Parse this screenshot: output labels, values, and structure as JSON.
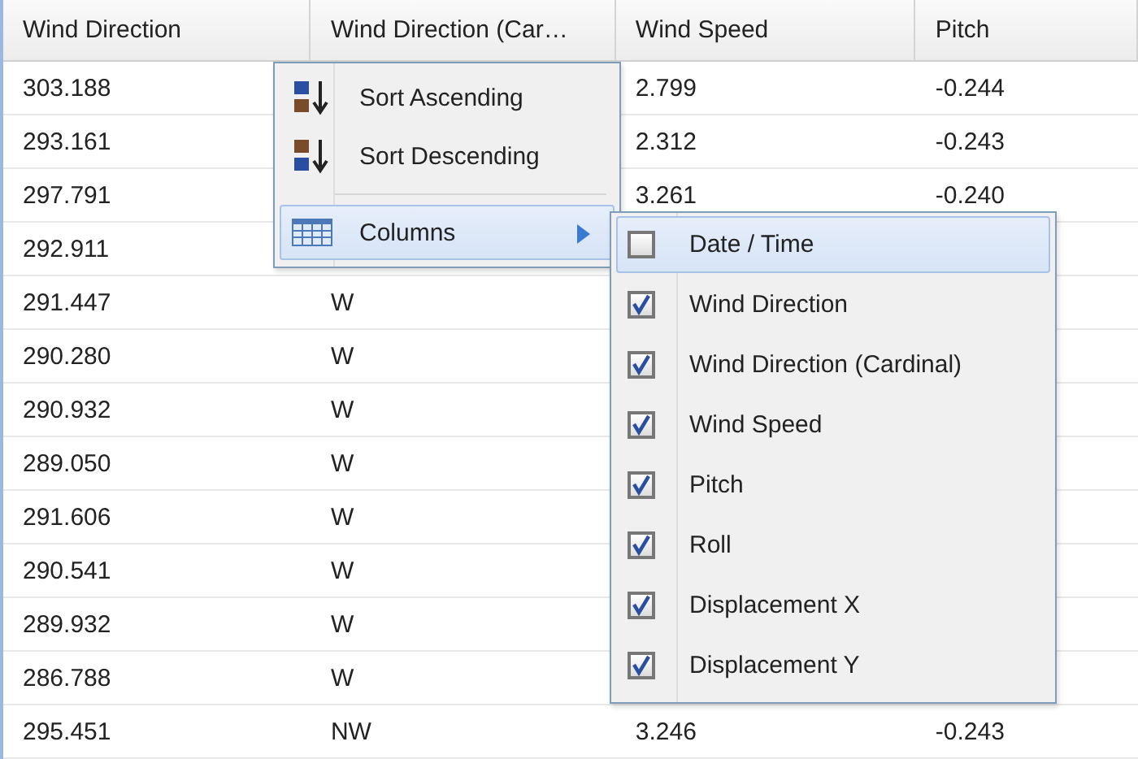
{
  "table": {
    "columns": [
      {
        "label": "Wind Direction"
      },
      {
        "label": "Wind Direction (Car…"
      },
      {
        "label": "Wind Speed"
      },
      {
        "label": "Pitch"
      }
    ],
    "rows": [
      {
        "cells": [
          "303.188",
          null,
          "2.799",
          "-0.244"
        ]
      },
      {
        "cells": [
          "293.161",
          null,
          "2.312",
          "-0.243"
        ]
      },
      {
        "cells": [
          "297.791",
          null,
          "3.261",
          "-0.240"
        ]
      },
      {
        "cells": [
          "292.911",
          null,
          null,
          null
        ]
      },
      {
        "cells": [
          "291.447",
          "W",
          null,
          null
        ]
      },
      {
        "cells": [
          "290.280",
          "W",
          null,
          null
        ]
      },
      {
        "cells": [
          "290.932",
          "W",
          null,
          null
        ]
      },
      {
        "cells": [
          "289.050",
          "W",
          null,
          null
        ]
      },
      {
        "cells": [
          "291.606",
          "W",
          null,
          null
        ]
      },
      {
        "cells": [
          "290.541",
          "W",
          null,
          null
        ]
      },
      {
        "cells": [
          "289.932",
          "W",
          null,
          null
        ]
      },
      {
        "cells": [
          "286.788",
          "W",
          null,
          null
        ]
      },
      {
        "cells": [
          "295.451",
          "NW",
          "3.246",
          "-0.243"
        ]
      }
    ]
  },
  "column_menu": {
    "items": [
      {
        "kind": "sort-ascending",
        "label": "Sort Ascending",
        "active": false
      },
      {
        "kind": "sort-descending",
        "label": "Sort Descending",
        "active": false
      },
      {
        "kind": "separator"
      },
      {
        "kind": "columns",
        "label": "Columns",
        "active": true
      }
    ]
  },
  "columns_submenu": {
    "items": [
      {
        "label": "Date / Time",
        "checked": false,
        "active": true
      },
      {
        "label": "Wind Direction",
        "checked": true,
        "active": false
      },
      {
        "label": "Wind Direction (Cardinal)",
        "checked": true,
        "active": false
      },
      {
        "label": "Wind Speed",
        "checked": true,
        "active": false
      },
      {
        "label": "Pitch",
        "checked": true,
        "active": false
      },
      {
        "label": "Roll",
        "checked": true,
        "active": false
      },
      {
        "label": "Displacement X",
        "checked": true,
        "active": false
      },
      {
        "label": "Displacement Y",
        "checked": true,
        "active": false
      }
    ]
  }
}
